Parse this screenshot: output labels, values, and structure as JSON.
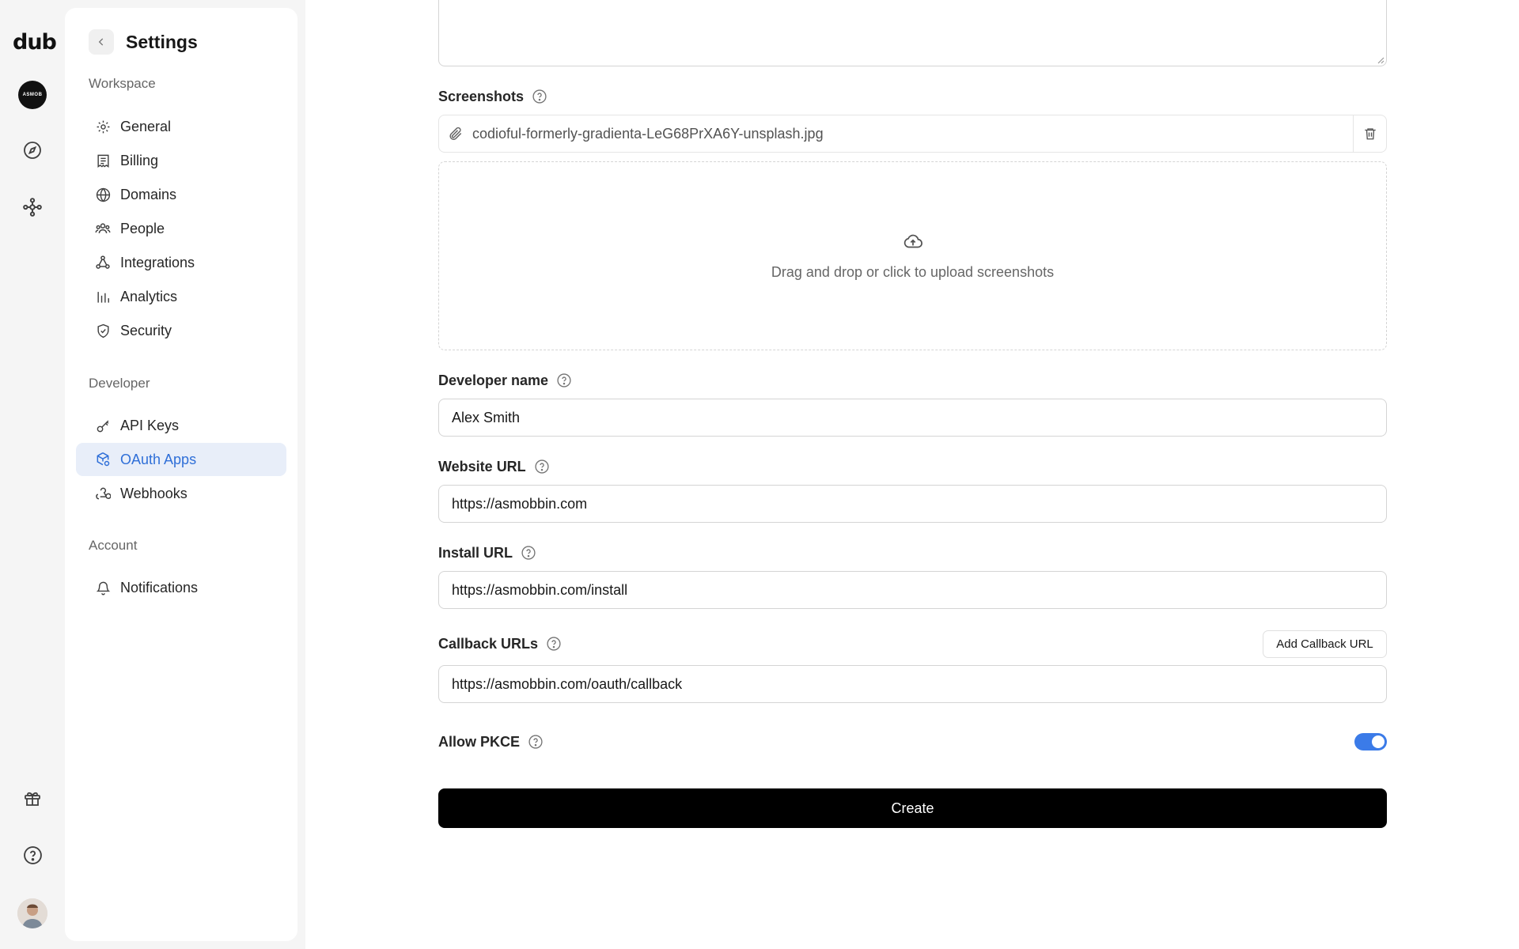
{
  "rail": {
    "logo": "dub",
    "workspace_avatar_text": "ASMOB",
    "icons": [
      "compass-icon",
      "integrations-icon",
      "gift-icon",
      "help-icon"
    ]
  },
  "settings": {
    "title": "Settings",
    "workspace_label": "Workspace",
    "workspace_items": [
      {
        "label": "General",
        "icon": "gear-icon"
      },
      {
        "label": "Billing",
        "icon": "receipt-icon"
      },
      {
        "label": "Domains",
        "icon": "globe-icon"
      },
      {
        "label": "People",
        "icon": "users-icon"
      },
      {
        "label": "Integrations",
        "icon": "integrations-icon"
      },
      {
        "label": "Analytics",
        "icon": "bar-chart-icon"
      },
      {
        "label": "Security",
        "icon": "shield-icon"
      }
    ],
    "developer_label": "Developer",
    "developer_items": [
      {
        "label": "API Keys",
        "icon": "key-icon"
      },
      {
        "label": "OAuth Apps",
        "icon": "cube-settings-icon",
        "active": true
      },
      {
        "label": "Webhooks",
        "icon": "webhook-icon"
      }
    ],
    "account_label": "Account",
    "account_items": [
      {
        "label": "Notifications",
        "icon": "bell-icon"
      }
    ]
  },
  "form": {
    "screenshots_label": "Screenshots",
    "screenshot_file": "codioful-formerly-gradienta-LeG68PrXA6Y-unsplash.jpg",
    "dropzone_text": "Drag and drop or click to upload screenshots",
    "developer_name_label": "Developer name",
    "developer_name_value": "Alex Smith",
    "website_url_label": "Website URL",
    "website_url_value": "https://asmobbin.com",
    "install_url_label": "Install URL",
    "install_url_value": "https://asmobbin.com/install",
    "callback_urls_label": "Callback URLs",
    "add_callback_button": "Add Callback URL",
    "callback_url_value": "https://asmobbin.com/oauth/callback",
    "allow_pkce_label": "Allow PKCE",
    "allow_pkce_enabled": true,
    "create_button": "Create"
  },
  "colors": {
    "accent": "#3b7be8",
    "active_nav_bg": "#e8eef9",
    "active_nav_text": "#2f6fd8",
    "primary_button": "#000000"
  }
}
